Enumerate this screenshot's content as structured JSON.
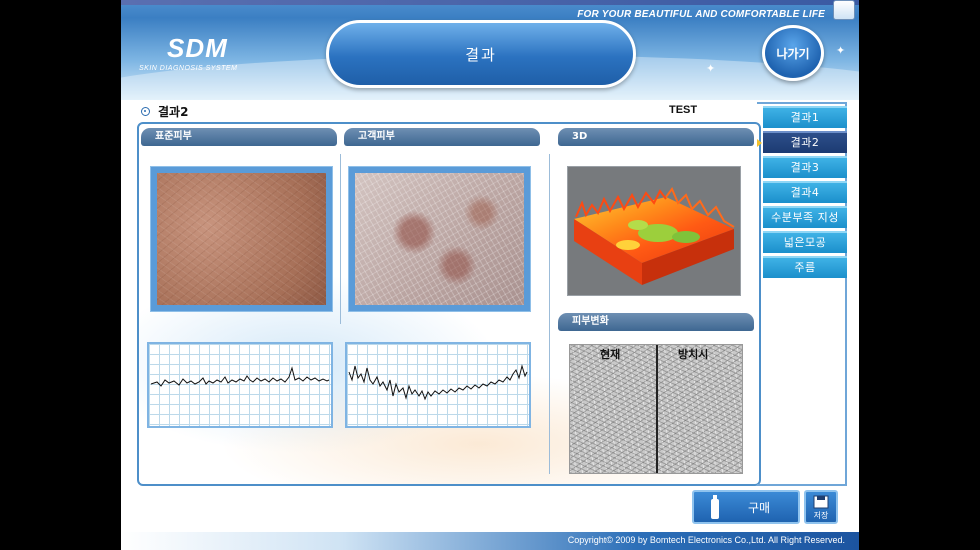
{
  "header": {
    "tagline": "FOR YOUR BEAUTIFUL AND COMFORTABLE LIFE",
    "logo": "SDM",
    "logo_sub": "SKIN DIAGNOSIS SYSTEM",
    "title": "결과",
    "exit_label": "나가기"
  },
  "subheader": {
    "title": "결과2",
    "user": "TEST"
  },
  "panels": {
    "standard_skin": "표준피부",
    "customer_skin": "고객피부",
    "three_d": "3D",
    "skin_change": "피부변화",
    "change_now": "현재",
    "change_neglect": "방치시"
  },
  "nav": {
    "items": [
      {
        "label": "결과1",
        "active": false
      },
      {
        "label": "결과2",
        "active": true
      },
      {
        "label": "결과3",
        "active": false
      },
      {
        "label": "결과4",
        "active": false
      },
      {
        "label": "수분부족 지성",
        "active": false
      },
      {
        "label": "넓은모공",
        "active": false
      },
      {
        "label": "주름",
        "active": false
      }
    ]
  },
  "bottom": {
    "buy_label": "구매",
    "save_label": "저장"
  },
  "footer": {
    "copyright": "Copyright© 2009 by Bomtech Electronics Co.,Ltd.  All Right Reserved."
  },
  "colors": {
    "accent": "#2b72c0",
    "nav_item": "#1b8fcb",
    "nav_active": "#1c3b72",
    "panel_border": "#4d8fc9"
  }
}
